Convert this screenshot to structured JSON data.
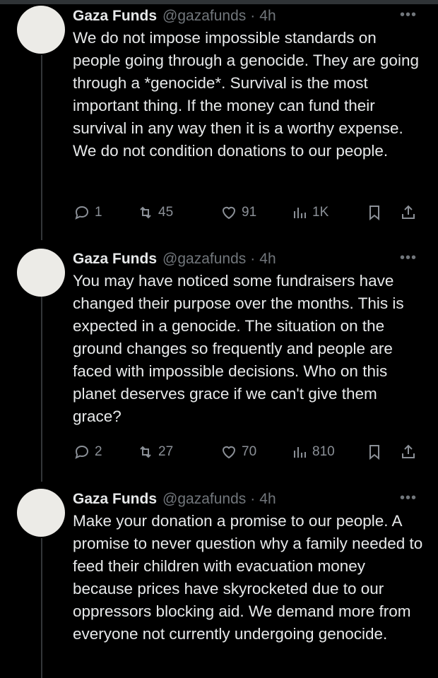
{
  "tweets": [
    {
      "name": "Gaza Funds",
      "handle": "@gazafunds",
      "separator": "·",
      "time": "4h",
      "more": "•••",
      "text": "We do not impose impossible standards on people going through a genocide. They are going through a *genocide*. Survival is the most important thing. If the money can fund their survival in any way then it is a worthy expense. We do not condition donations to our people.",
      "replies": "1",
      "reposts": "45",
      "likes": "91",
      "views": "1K"
    },
    {
      "name": "Gaza Funds",
      "handle": "@gazafunds",
      "separator": "·",
      "time": "4h",
      "more": "•••",
      "text": "You may have noticed some fundraisers have changed their purpose over the months. This is expected in a genocide. The situation on the ground changes so frequently and people are faced with impossible decisions. Who on this planet deserves grace if we can't give them grace?",
      "replies": "2",
      "reposts": "27",
      "likes": "70",
      "views": "810"
    },
    {
      "name": "Gaza Funds",
      "handle": "@gazafunds",
      "separator": "·",
      "time": "4h",
      "more": "•••",
      "text": "Make your donation a promise to our people. A promise to never question why a family needed to feed their children with evacuation money because prices have skyrocketed due to our oppressors blocking aid. We demand more from everyone not currently undergoing genocide."
    }
  ],
  "icons": {
    "reply": "reply-icon",
    "repost": "repost-icon",
    "like": "heart-icon",
    "views": "views-icon",
    "bookmark": "bookmark-icon",
    "share": "share-icon",
    "more": "more-icon"
  },
  "colors": {
    "background": "#000000",
    "text": "#e7e9ea",
    "muted": "#71767b",
    "avatar": "#ecebe7"
  }
}
